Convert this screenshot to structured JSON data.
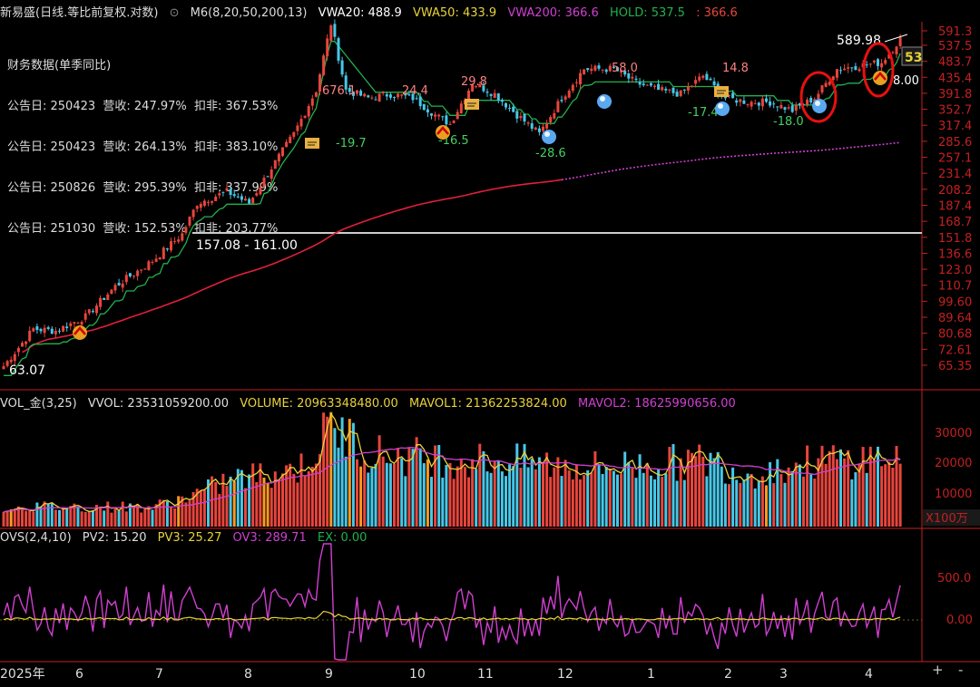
{
  "colors": {
    "up": "#e8453c",
    "down": "#46c8e8",
    "hold": "#22b14c",
    "vwa200": "#e0203a",
    "magenta": "#d040d0",
    "yellow": "#e8d23a",
    "orange": "#ff9a1e",
    "axis": "#c42020",
    "grid": "#3a0a0a",
    "text": "#dddddd",
    "white": "#ffffff"
  },
  "header": {
    "title": "新易盛(日线.等比前复权.对数)",
    "m6": "M6(8,20,50,200,13)",
    "vwa20": "VWA20: 488.9",
    "vwa50": "VWA50: 433.9",
    "vwa200": "VWA200: 366.6",
    "hold": "HOLD: 537.5",
    "hold2": ": 366.6"
  },
  "financial": {
    "title": "财务数据(单季同比)",
    "rows": [
      "公告日: 250423  营收: 247.97%  扣非: 367.53%",
      "公告日: 250423  营收: 264.13%  扣非: 383.10%",
      "公告日: 250826  营收: 295.39%  扣非: 337.99%",
      "公告日: 251030  营收: 152.53%  扣非: 203.77%"
    ]
  },
  "annotations": {
    "range_label": "157.08 - 161.00",
    "low_label": "63.07",
    "high_label": "589.98",
    "hold_tag": "53",
    "price_marks": [
      "676.1",
      "24.4",
      "29.8",
      "58.0",
      "14.8",
      "-19.7",
      "-16.5",
      "-28.6",
      "-17.4",
      "-18.0",
      "8.00"
    ]
  },
  "volume_panel": {
    "name": "VOL_金(3,25)",
    "vvol": "VVOL: 23531059200.00",
    "volume": "VOLUME: 20963348480.00",
    "mavol1": "MAVOL1: 21362253824.00",
    "mavol2": "MAVOL2: 18625990656.00",
    "ticks": [
      "30000",
      "20000",
      "10000"
    ],
    "unit": "X100万"
  },
  "ovs_panel": {
    "name": "OVS(2,4,10)",
    "pv2": "PV2: 15.20",
    "pv3": "PV3: 25.27",
    "ov3": "OV3: 289.71",
    "ex": "EX: 0.00",
    "ticks": [
      "500.0",
      "0.00"
    ]
  },
  "x_axis": {
    "labels": [
      "2025年",
      "6",
      "7",
      "8",
      "9",
      "10",
      "11",
      "12",
      "1",
      "2",
      "3",
      "4"
    ],
    "controls": [
      "+",
      "-"
    ]
  },
  "chart_data": {
    "type": "candlestick",
    "y_scale": "log",
    "price_ticks": [
      "591.3",
      "537.5",
      "483.7",
      "435.4",
      "391.8",
      "352.7",
      "317.4",
      "285.6",
      "257.1",
      "231.4",
      "208.2",
      "187.4",
      "168.7",
      "151.8",
      "136.6",
      "123.0",
      "110.7",
      "99.60",
      "89.64",
      "80.68",
      "72.61",
      "65.35"
    ],
    "anchors": [
      {
        "t": 0,
        "p": 65
      },
      {
        "t": 8,
        "p": 83
      },
      {
        "t": 14,
        "p": 82
      },
      {
        "t": 22,
        "p": 90
      },
      {
        "t": 30,
        "p": 110
      },
      {
        "t": 40,
        "p": 130
      },
      {
        "t": 48,
        "p": 155
      },
      {
        "t": 52,
        "p": 190
      },
      {
        "t": 60,
        "p": 205
      },
      {
        "t": 66,
        "p": 190
      },
      {
        "t": 72,
        "p": 240
      },
      {
        "t": 78,
        "p": 300
      },
      {
        "t": 84,
        "p": 400
      },
      {
        "t": 88,
        "p": 620
      },
      {
        "t": 92,
        "p": 400
      },
      {
        "t": 98,
        "p": 380
      },
      {
        "t": 104,
        "p": 390
      },
      {
        "t": 110,
        "p": 380
      },
      {
        "t": 116,
        "p": 340
      },
      {
        "t": 120,
        "p": 320
      },
      {
        "t": 126,
        "p": 420
      },
      {
        "t": 132,
        "p": 390
      },
      {
        "t": 138,
        "p": 340
      },
      {
        "t": 144,
        "p": 300
      },
      {
        "t": 150,
        "p": 380
      },
      {
        "t": 156,
        "p": 460
      },
      {
        "t": 164,
        "p": 460
      },
      {
        "t": 170,
        "p": 420
      },
      {
        "t": 176,
        "p": 400
      },
      {
        "t": 182,
        "p": 390
      },
      {
        "t": 188,
        "p": 440
      },
      {
        "t": 194,
        "p": 380
      },
      {
        "t": 200,
        "p": 370
      },
      {
        "t": 206,
        "p": 370
      },
      {
        "t": 212,
        "p": 350
      },
      {
        "t": 218,
        "p": 380
      },
      {
        "t": 224,
        "p": 460
      },
      {
        "t": 230,
        "p": 470
      },
      {
        "t": 236,
        "p": 480
      },
      {
        "t": 241,
        "p": 560
      }
    ],
    "volume_anchors": [
      {
        "t": 0,
        "v": 6000
      },
      {
        "t": 40,
        "v": 6000
      },
      {
        "t": 60,
        "v": 14000
      },
      {
        "t": 80,
        "v": 18000
      },
      {
        "t": 88,
        "v": 31000
      },
      {
        "t": 100,
        "v": 22000
      },
      {
        "t": 130,
        "v": 20000
      },
      {
        "t": 160,
        "v": 18000
      },
      {
        "t": 190,
        "v": 20000
      },
      {
        "t": 200,
        "v": 16000
      },
      {
        "t": 220,
        "v": 20000
      },
      {
        "t": 241,
        "v": 21000
      }
    ],
    "volume_ylim": [
      0,
      35000
    ],
    "ovs_ylim": [
      -200,
      800
    ]
  }
}
